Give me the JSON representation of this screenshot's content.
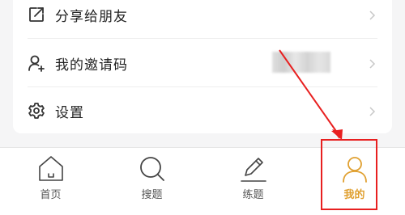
{
  "menu": {
    "share": {
      "label": "分享给朋友",
      "icon": "share-icon"
    },
    "invite": {
      "label": "我的邀请码",
      "icon": "person-add-icon"
    },
    "settings": {
      "label": "设置",
      "icon": "gear-icon"
    }
  },
  "tabbar": {
    "tabs": [
      {
        "label": "首页",
        "icon": "home-icon"
      },
      {
        "label": "搜题",
        "icon": "search-icon"
      },
      {
        "label": "练题",
        "icon": "pencil-icon"
      },
      {
        "label": "我的",
        "icon": "person-icon",
        "active": true
      }
    ]
  },
  "colors": {
    "accent": "#e0a030",
    "annotation": "#e82020"
  }
}
